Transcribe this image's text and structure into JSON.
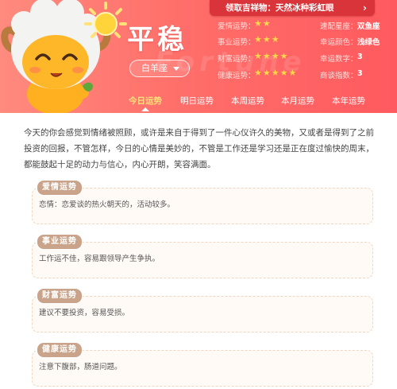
{
  "promo": {
    "label": "领取吉祥物：天然冰种彩虹眼",
    "arrow": "›"
  },
  "title": "平稳",
  "sign": "白羊座",
  "watermark": "Fortune",
  "stats": [
    {
      "label": "爱情运势：",
      "stars": 2,
      "label2": "速配星座：",
      "value2": "双鱼座"
    },
    {
      "label": "事业运势：",
      "stars": 3,
      "label2": "幸运颜色：",
      "value2": "浅绿色"
    },
    {
      "label": "财富运势：",
      "stars": 4,
      "label2": "幸运数字：",
      "value2": "3"
    },
    {
      "label": "健康运势：",
      "stars": 5,
      "label2": "商谈指数：",
      "value2": "3"
    }
  ],
  "tabs": [
    {
      "label": "今日运势",
      "active": true
    },
    {
      "label": "明日运势",
      "active": false
    },
    {
      "label": "本周运势",
      "active": false
    },
    {
      "label": "本月运势",
      "active": false
    },
    {
      "label": "本年运势",
      "active": false
    }
  ],
  "summary": "今天的你会感觉到情绪被照顾，或许是来自于得到了一件心仪许久的美物，又或者是得到了之前投资的回报，不管怎样，今日的心情是美妙的，不管是工作还是学习还是正在度过愉快的周末，都能鼓起十足的动力与信心，内心开朗，笑容满面。",
  "sections": [
    {
      "badge": "爱情运势",
      "text": "恋情：恋爱谈的热火朝天的，活动较多。"
    },
    {
      "badge": "事业运势",
      "text": "工作运不佳，容易跟领导产生争执。"
    },
    {
      "badge": "财富运势",
      "text": "建议不要投资，容易受损。"
    },
    {
      "badge": "健康运势",
      "text": "注意下腹部，肠道问题。"
    }
  ],
  "colors": {
    "header": "#ff6f6a",
    "star": "#ffd84a",
    "active_tab": "#ffe07a",
    "badge": "#c9a48a"
  },
  "icons": {
    "sun": "sun-icon",
    "mascot": "ram-mascot",
    "dropdown": "chevron-down-icon"
  }
}
